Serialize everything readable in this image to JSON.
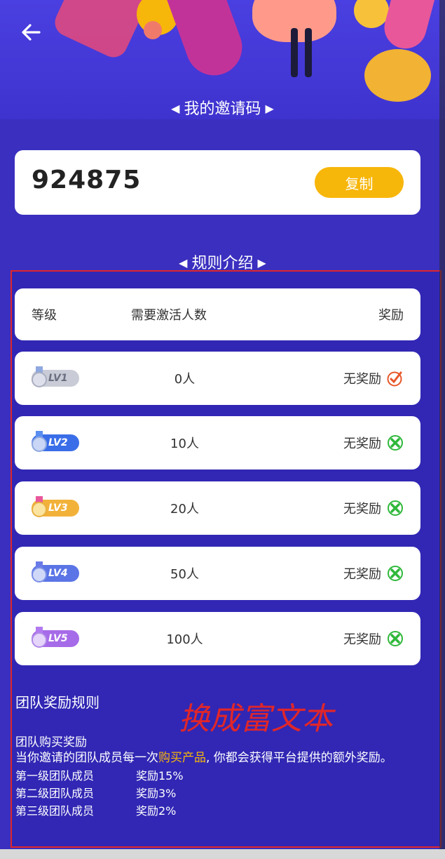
{
  "invite_section": {
    "title": "我的邀请码",
    "code": "924875",
    "copy_label": "复制"
  },
  "rules_section": {
    "title": "规则介绍",
    "headers": {
      "level": "等级",
      "required": "需要激活人数",
      "reward": "奖励"
    },
    "rows": [
      {
        "badge": "LV1",
        "required": "0人",
        "reward": "无奖励",
        "status_icon": "check-icon",
        "badge_color": "#c9ccd6"
      },
      {
        "badge": "LV2",
        "required": "10人",
        "reward": "无奖励",
        "status_icon": "cross-icon",
        "badge_color": "#3a6ee8"
      },
      {
        "badge": "LV3",
        "required": "20人",
        "reward": "无奖励",
        "status_icon": "cross-icon",
        "badge_color": "#f2b23a"
      },
      {
        "badge": "LV4",
        "required": "50人",
        "reward": "无奖励",
        "status_icon": "cross-icon",
        "badge_color": "#5b74e6"
      },
      {
        "badge": "LV5",
        "required": "100人",
        "reward": "无奖励",
        "status_icon": "cross-icon",
        "badge_color": "#a66be8"
      }
    ]
  },
  "team_rules": {
    "title": "团队奖励规则",
    "subtitle": "团队购买奖励",
    "para_before": "当你邀请的团队成员每一次",
    "para_highlight": "购买产品",
    "para_after": ", 你都会获得平台提供的额外奖励。",
    "tiers": [
      {
        "label": "第一级团队成员",
        "reward": "奖励15%"
      },
      {
        "label": "第二级团队成员",
        "reward": "奖励3%"
      },
      {
        "label": "第三级团队成员",
        "reward": "奖励2%"
      }
    ]
  },
  "annotation": "换成富文本",
  "colors": {
    "background": "#3a2fbf",
    "accent": "#f7b60a",
    "annotation_red": "#e0262a",
    "check": "#e8572a",
    "cross": "#2fb83a"
  }
}
